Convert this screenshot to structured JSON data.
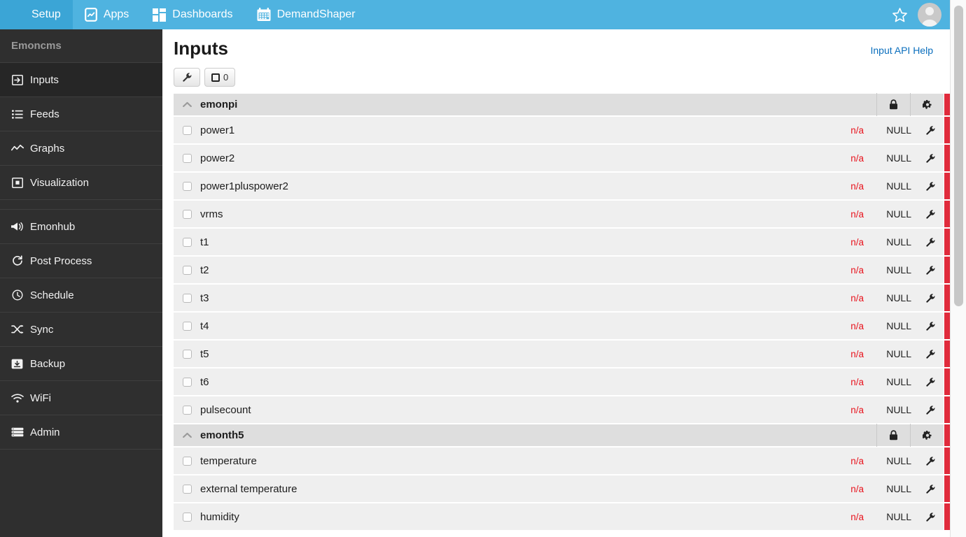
{
  "navbar": {
    "items": [
      {
        "label": "Setup",
        "icon": "hamburger-icon",
        "active": true
      },
      {
        "label": "Apps",
        "icon": "mobile-app-icon",
        "active": false
      },
      {
        "label": "Dashboards",
        "icon": "dashboard-grid-icon",
        "active": false
      },
      {
        "label": "DemandShaper",
        "icon": "calendar-icon",
        "active": false
      }
    ],
    "star_icon": "star-outline-icon",
    "avatar_icon": "user-avatar-icon"
  },
  "sidebar": {
    "title": "Emoncms",
    "items": [
      {
        "label": "Inputs",
        "icon": "input-arrow-icon",
        "active": true
      },
      {
        "label": "Feeds",
        "icon": "list-icon",
        "active": false
      },
      {
        "label": "Graphs",
        "icon": "line-chart-icon",
        "active": false
      },
      {
        "label": "Visualization",
        "icon": "visualization-icon",
        "active": false
      },
      {
        "label": "Emonhub",
        "icon": "megaphone-icon",
        "active": false
      },
      {
        "label": "Post Process",
        "icon": "refresh-icon",
        "active": false
      },
      {
        "label": "Schedule",
        "icon": "clock-icon",
        "active": false
      },
      {
        "label": "Sync",
        "icon": "sync-icon",
        "active": false
      },
      {
        "label": "Backup",
        "icon": "backup-icon",
        "active": false
      },
      {
        "label": "WiFi",
        "icon": "wifi-icon",
        "active": false
      },
      {
        "label": "Admin",
        "icon": "server-icon",
        "active": false
      }
    ]
  },
  "page": {
    "title": "Inputs",
    "api_help_label": "Input API Help"
  },
  "toolbar": {
    "config_icon": "wrench-icon",
    "select_count": "0",
    "select_icon": "checkbox-icon"
  },
  "table": {
    "groups": [
      {
        "name": "emonpi",
        "collapse_icon": "chevron-up-icon",
        "lock_icon": "padlock-icon",
        "gear_icon": "gear-icon",
        "rows": [
          {
            "name": "power1",
            "time": "n/a",
            "value": "NULL",
            "tool_icon": "wrench-icon"
          },
          {
            "name": "power2",
            "time": "n/a",
            "value": "NULL",
            "tool_icon": "wrench-icon"
          },
          {
            "name": "power1pluspower2",
            "time": "n/a",
            "value": "NULL",
            "tool_icon": "wrench-icon"
          },
          {
            "name": "vrms",
            "time": "n/a",
            "value": "NULL",
            "tool_icon": "wrench-icon"
          },
          {
            "name": "t1",
            "time": "n/a",
            "value": "NULL",
            "tool_icon": "wrench-icon"
          },
          {
            "name": "t2",
            "time": "n/a",
            "value": "NULL",
            "tool_icon": "wrench-icon"
          },
          {
            "name": "t3",
            "time": "n/a",
            "value": "NULL",
            "tool_icon": "wrench-icon"
          },
          {
            "name": "t4",
            "time": "n/a",
            "value": "NULL",
            "tool_icon": "wrench-icon"
          },
          {
            "name": "t5",
            "time": "n/a",
            "value": "NULL",
            "tool_icon": "wrench-icon"
          },
          {
            "name": "t6",
            "time": "n/a",
            "value": "NULL",
            "tool_icon": "wrench-icon"
          },
          {
            "name": "pulsecount",
            "time": "n/a",
            "value": "NULL",
            "tool_icon": "wrench-icon"
          }
        ]
      },
      {
        "name": "emonth5",
        "collapse_icon": "chevron-up-icon",
        "lock_icon": "padlock-icon",
        "gear_icon": "gear-icon",
        "rows": [
          {
            "name": "temperature",
            "time": "n/a",
            "value": "NULL",
            "tool_icon": "wrench-icon"
          },
          {
            "name": "external temperature",
            "time": "n/a",
            "value": "NULL",
            "tool_icon": "wrench-icon"
          },
          {
            "name": "humidity",
            "time": "n/a",
            "value": "NULL",
            "tool_icon": "wrench-icon"
          }
        ]
      }
    ]
  },
  "colors": {
    "navbar": "#4fb3e0",
    "navbar_active": "#3ba5d6",
    "sidebar": "#2f2f2f",
    "sidebar_active": "#262626",
    "row": "#efefef",
    "group_row": "#dedede",
    "status_red": "#e8131d",
    "bar_red": "#e02b3c",
    "link_blue": "#0a6ebd"
  }
}
